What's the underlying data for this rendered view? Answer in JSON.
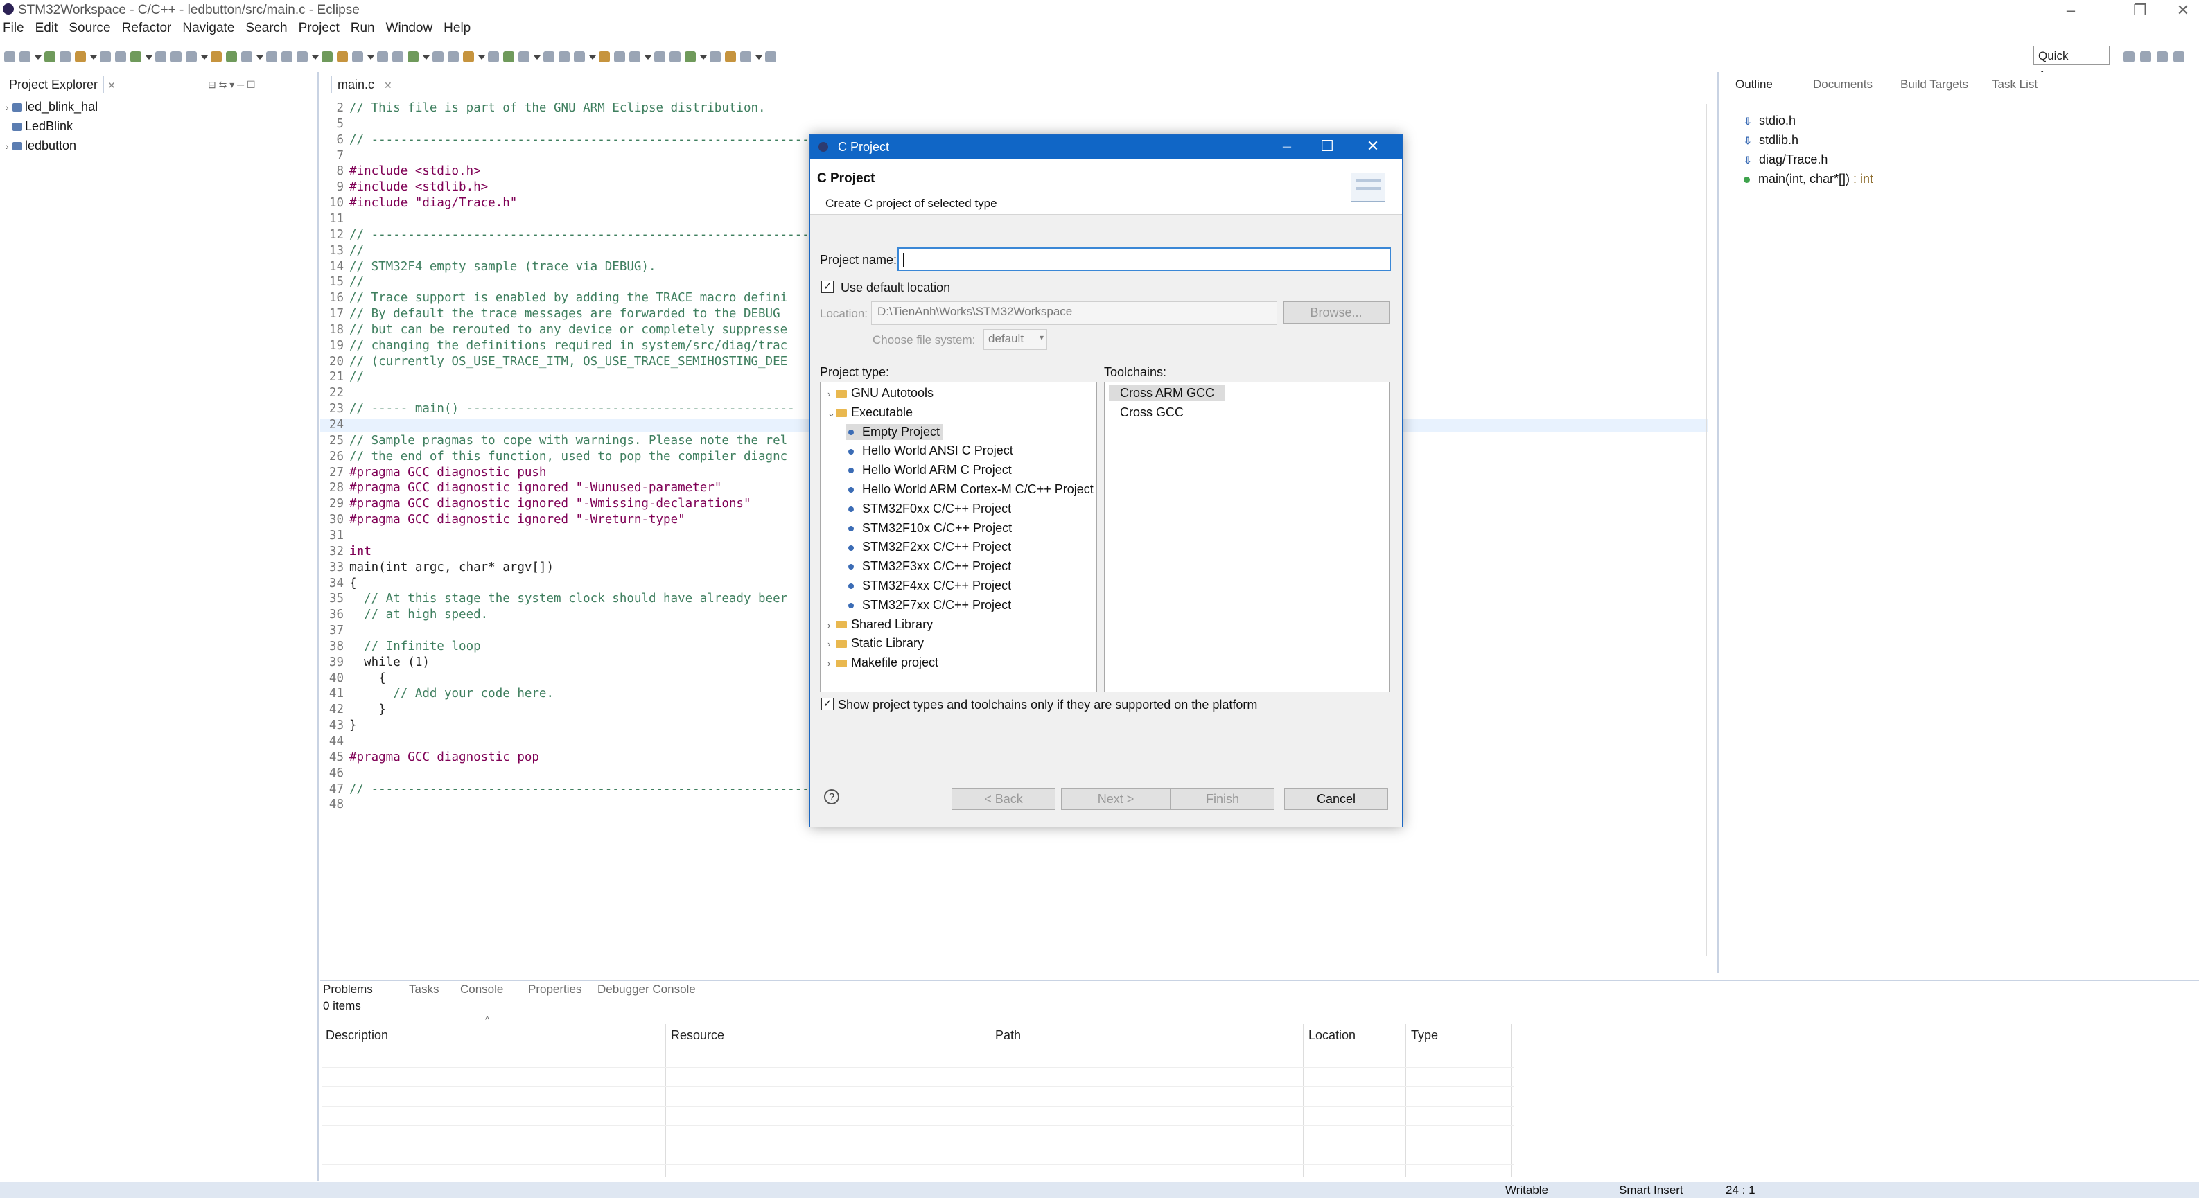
{
  "window": {
    "title": "STM32Workspace - C/C++ - ledbutton/src/main.c - Eclipse"
  },
  "menu": [
    "File",
    "Edit",
    "Source",
    "Refactor",
    "Navigate",
    "Search",
    "Project",
    "Run",
    "Window",
    "Help"
  ],
  "toolbar": {
    "quick_access": "Quick Access"
  },
  "project_explorer": {
    "tab_label": "Project Explorer",
    "projects": [
      "led_blink_hal",
      "LedBlink",
      "ledbutton"
    ]
  },
  "editor": {
    "tab_label": "main.c",
    "lines": [
      {
        "n": "2",
        "text": "// This file is part of the GNU ARM Eclipse distribution."
      },
      {
        "n": "5",
        "text": ""
      },
      {
        "n": "6",
        "text": "// ----------------------------------------------------------------------------"
      },
      {
        "n": "7",
        "text": ""
      },
      {
        "n": "8",
        "text": "#include <stdio.h>"
      },
      {
        "n": "9",
        "text": "#include <stdlib.h>"
      },
      {
        "n": "10",
        "text": "#include \"diag/Trace.h\""
      },
      {
        "n": "11",
        "text": ""
      },
      {
        "n": "12",
        "text": "// ----------------------------------------------------------------------------"
      },
      {
        "n": "13",
        "text": "//"
      },
      {
        "n": "14",
        "text": "// STM32F4 empty sample (trace via DEBUG)."
      },
      {
        "n": "15",
        "text": "//"
      },
      {
        "n": "16",
        "text": "// Trace support is enabled by adding the TRACE macro defini"
      },
      {
        "n": "17",
        "text": "// By default the trace messages are forwarded to the DEBUG"
      },
      {
        "n": "18",
        "text": "// but can be rerouted to any device or completely suppresse"
      },
      {
        "n": "19",
        "text": "// changing the definitions required in system/src/diag/trac"
      },
      {
        "n": "20",
        "text": "// (currently OS_USE_TRACE_ITM, OS_USE_TRACE_SEMIHOSTING_DEE"
      },
      {
        "n": "21",
        "text": "//"
      },
      {
        "n": "22",
        "text": ""
      },
      {
        "n": "23",
        "text": "// ----- main() ---------------------------------------------"
      },
      {
        "n": "24",
        "text": ""
      },
      {
        "n": "25",
        "text": "// Sample pragmas to cope with warnings. Please note the rel"
      },
      {
        "n": "26",
        "text": "// the end of this function, used to pop the compiler diagnc"
      },
      {
        "n": "27",
        "text": "#pragma GCC diagnostic push"
      },
      {
        "n": "28",
        "text": "#pragma GCC diagnostic ignored \"-Wunused-parameter\""
      },
      {
        "n": "29",
        "text": "#pragma GCC diagnostic ignored \"-Wmissing-declarations\""
      },
      {
        "n": "30",
        "text": "#pragma GCC diagnostic ignored \"-Wreturn-type\""
      },
      {
        "n": "31",
        "text": ""
      },
      {
        "n": "32",
        "text": "int"
      },
      {
        "n": "33",
        "text": "main(int argc, char* argv[])"
      },
      {
        "n": "34",
        "text": "{"
      },
      {
        "n": "35",
        "text": "  // At this stage the system clock should have already beer"
      },
      {
        "n": "36",
        "text": "  // at high speed."
      },
      {
        "n": "37",
        "text": ""
      },
      {
        "n": "38",
        "text": "  // Infinite loop"
      },
      {
        "n": "39",
        "text": "  while (1)"
      },
      {
        "n": "40",
        "text": "    {"
      },
      {
        "n": "41",
        "text": "      // Add your code here."
      },
      {
        "n": "42",
        "text": "    }"
      },
      {
        "n": "43",
        "text": "}"
      },
      {
        "n": "44",
        "text": ""
      },
      {
        "n": "45",
        "text": "#pragma GCC diagnostic pop"
      },
      {
        "n": "46",
        "text": ""
      },
      {
        "n": "47",
        "text": "// ----------------------------------------------------------------------------"
      },
      {
        "n": "48",
        "text": ""
      }
    ]
  },
  "right_tabs": [
    "Outline",
    "Documents",
    "Build Targets",
    "Task List"
  ],
  "outline": {
    "items": [
      "stdio.h",
      "stdlib.h",
      "diag/Trace.h"
    ],
    "main_sig": "main(int, char*[])",
    "main_ret": " : int"
  },
  "bottom": {
    "tabs": [
      "Problems",
      "Tasks",
      "Console",
      "Properties",
      "Debugger Console"
    ],
    "count": "0 items",
    "columns": [
      "Description",
      "Resource",
      "Path",
      "Location",
      "Type"
    ]
  },
  "status": {
    "writable": "Writable",
    "insert_mode": "Smart Insert",
    "position": "24 : 1"
  },
  "dialog": {
    "title": "C Project",
    "header_title": "C Project",
    "header_desc": "Create C project of selected type",
    "project_name_label": "Project name:",
    "project_name_value": "",
    "use_default_label": "Use default location",
    "use_default_checked": true,
    "location_label": "Location:",
    "location_value": "D:\\TienAnh\\Works\\STM32Workspace",
    "browse_label": "Browse...",
    "filesystem_label": "Choose file system:",
    "filesystem_value": "default",
    "project_type_label": "Project type:",
    "toolchains_label": "Toolchains:",
    "types": [
      {
        "label": "GNU Autotools",
        "kind": "folder",
        "expanded": false
      },
      {
        "label": "Executable",
        "kind": "folder",
        "expanded": true
      },
      {
        "label": "Empty Project",
        "kind": "item",
        "selected": true
      },
      {
        "label": "Hello World ANSI C Project",
        "kind": "item"
      },
      {
        "label": "Hello World ARM C Project",
        "kind": "item"
      },
      {
        "label": "Hello World ARM Cortex-M C/C++ Project",
        "kind": "item"
      },
      {
        "label": "STM32F0xx C/C++ Project",
        "kind": "item"
      },
      {
        "label": "STM32F10x C/C++ Project",
        "kind": "item"
      },
      {
        "label": "STM32F2xx C/C++ Project",
        "kind": "item"
      },
      {
        "label": "STM32F3xx C/C++ Project",
        "kind": "item"
      },
      {
        "label": "STM32F4xx C/C++ Project",
        "kind": "item"
      },
      {
        "label": "STM32F7xx C/C++ Project",
        "kind": "item"
      },
      {
        "label": "Shared Library",
        "kind": "folder",
        "expanded": false
      },
      {
        "label": "Static Library",
        "kind": "folder",
        "expanded": false
      },
      {
        "label": "Makefile project",
        "kind": "folder",
        "expanded": false
      }
    ],
    "toolchains": [
      {
        "label": "Cross ARM GCC",
        "selected": true
      },
      {
        "label": "Cross GCC",
        "selected": false
      }
    ],
    "show_supported_label": "Show project types and toolchains only if they are supported on the platform",
    "show_supported_checked": true,
    "buttons": {
      "back": "< Back",
      "next": "Next >",
      "finish": "Finish",
      "cancel": "Cancel"
    }
  }
}
